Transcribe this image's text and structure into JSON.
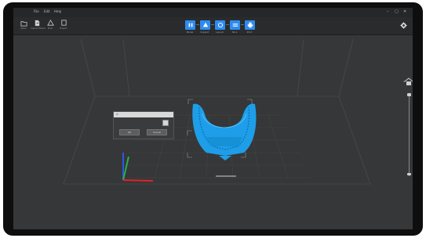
{
  "window": {
    "app_title": "",
    "menus": [
      "File",
      "Edit",
      "Help"
    ],
    "controls": [
      "–",
      "▢",
      "✕"
    ]
  },
  "toolbar": {
    "tools": [
      {
        "icon": "folder-open-icon",
        "label": "Open"
      },
      {
        "icon": "import-icon",
        "label": "Import Model"
      },
      {
        "icon": "print-icon",
        "label": "Print"
      },
      {
        "icon": "export-icon",
        "label": "Export"
      }
    ],
    "steps": [
      {
        "icon": "model-icon",
        "label": "Model"
      },
      {
        "icon": "support-icon",
        "label": "Support"
      },
      {
        "icon": "layout-icon",
        "label": "Layout"
      },
      {
        "icon": "slice-icon",
        "label": "Slice"
      },
      {
        "icon": "print-icon",
        "label": "Print"
      }
    ],
    "settings_icon": "gear-icon",
    "accent": "#2e8cf0"
  },
  "dialog": {
    "title": "",
    "field_label": "",
    "field_value": "",
    "checkbox_checked": false,
    "ok_label": "OK",
    "cancel_label": "Cancel"
  },
  "viewport": {
    "model_color": "#1e9ee8",
    "axis_colors": {
      "x": "#e0222a",
      "y": "#22b24c",
      "z": "#2f56e0"
    },
    "view_control": "home-view-icon",
    "zoom_label": ""
  },
  "log_lines": [
    "",
    "",
    "",
    "",
    ""
  ]
}
